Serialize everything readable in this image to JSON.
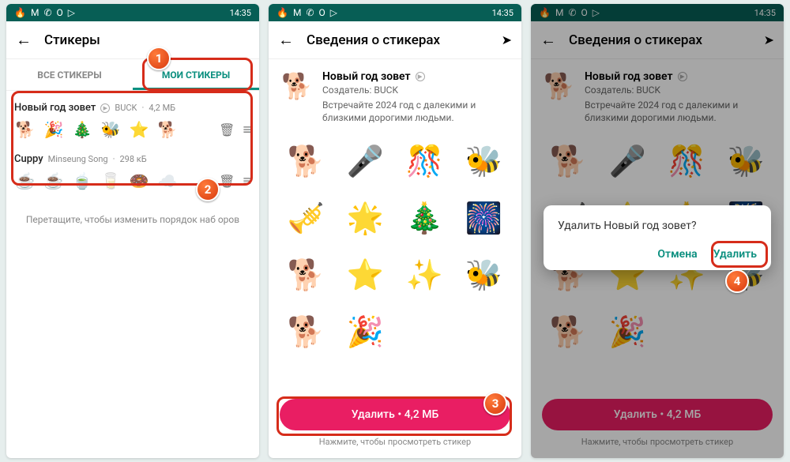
{
  "status": {
    "time": "14:35",
    "icons": [
      "🔥",
      "M",
      "✆",
      "O",
      "▷"
    ]
  },
  "screen1": {
    "title": "Стикеры",
    "tabs": {
      "all": "ВСЕ СТИКЕРЫ",
      "mine": "МОИ СТИКЕРЫ"
    },
    "packs": [
      {
        "name": "Новый год зовет",
        "author": "BUCK",
        "size": "4,2 МБ",
        "emojis": [
          "🐕",
          "🎉",
          "🎄",
          "🐝",
          "⭐",
          "🐕"
        ]
      },
      {
        "name": "Cuppy",
        "author": "Minseung Song",
        "size": "298 кБ",
        "emojis": [
          "☕",
          "☕",
          "🍵",
          "🥛",
          "🍩",
          "☁️"
        ]
      }
    ],
    "drag_hint": "Перетащите, чтобы изменить порядок наб              оров",
    "markers": {
      "m1": "1",
      "m2": "2"
    }
  },
  "detail": {
    "title": "Сведения о стикерах",
    "pack_name": "Новый год зовет",
    "creator_label": "Создатель: BUCK",
    "desc": "Встречайте 2024 год с далекими и близкими дорогими людьми.",
    "grid": [
      "🐕",
      "🎤",
      "🎊",
      "🐝",
      "🎺",
      "🌟",
      "🎄",
      "🎆",
      "🐕",
      "⭐",
      "✨",
      "🐝",
      "🐕",
      "🎉",
      "",
      ""
    ],
    "delete_label": "Удалить • 4,2 МБ",
    "tap_hint": "Нажмите, чтобы просмотреть стикер",
    "m3": "3"
  },
  "dialog": {
    "msg": "Удалить Новый год зовет?",
    "cancel": "Отмена",
    "ok": "Удалить",
    "m4": "4"
  }
}
